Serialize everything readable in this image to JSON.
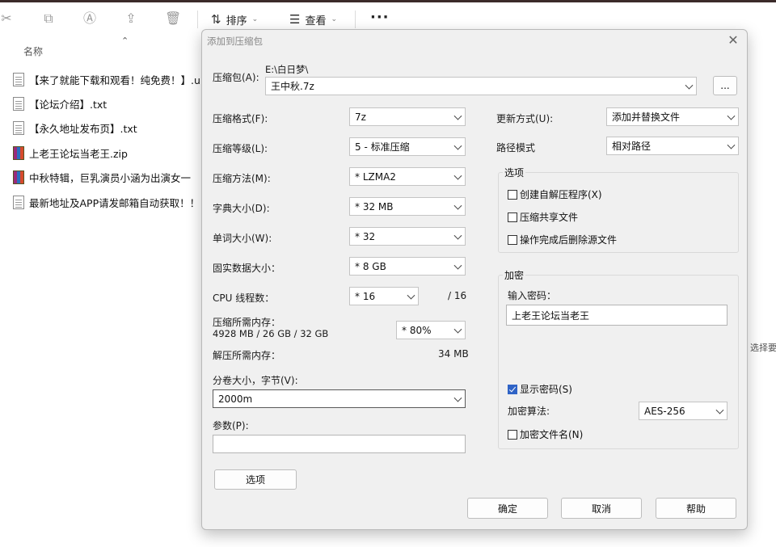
{
  "toolbar": {
    "sort_label": "排序",
    "view_label": "查看",
    "more_glyph": "···"
  },
  "explorer": {
    "column_name": "名称",
    "files": [
      {
        "name": "【来了就能下载和观看！纯免费！】.url",
        "type": "txt"
      },
      {
        "name": "【论坛介绍】.txt",
        "type": "txt"
      },
      {
        "name": "【永久地址发布页】.txt",
        "type": "txt"
      },
      {
        "name": "上老王论坛当老王.zip",
        "type": "zip"
      },
      {
        "name": "中秋特辑，巨乳演员小涵为出演女一",
        "type": "zip"
      },
      {
        "name": "最新地址及APP请发邮箱自动获取！！",
        "type": "txt"
      }
    ],
    "right_snippet": "选择要"
  },
  "dialog": {
    "title": "添加到压缩包",
    "archive_label": "压缩包(A):",
    "archive_dir": "E:\\白日梦\\",
    "archive_name": "王中秋.7z",
    "browse_label": "...",
    "format_label": "压缩格式(F):",
    "format_value": "7z",
    "level_label": "压缩等级(L):",
    "level_value": "5 - 标准压缩",
    "method_label": "压缩方法(M):",
    "method_value": "* LZMA2",
    "dict_label": "字典大小(D):",
    "dict_value": "* 32 MB",
    "word_label": "单词大小(W):",
    "word_value": "* 32",
    "solid_label": "固实数据大小：",
    "solid_value": "* 8 GB",
    "threads_label": "CPU 线程数：",
    "threads_value": "* 16",
    "threads_max": "/ 16",
    "mem_comp_label": "压缩所需内存：",
    "mem_comp_detail": "4928 MB / 26 GB / 32 GB",
    "mem_comp_value": "* 80%",
    "mem_decomp_label": "解压所需内存：",
    "mem_decomp_value": "34 MB",
    "split_label": "分卷大小，字节(V):",
    "split_value": "2000m",
    "params_label": "参数(P):",
    "params_value": "",
    "options_button": "选项",
    "update_label": "更新方式(U):",
    "update_value": "添加并替换文件",
    "path_label": "路径模式",
    "path_value": "相对路径",
    "options_group": "选项",
    "opt_sfx": "创建自解压程序(X)",
    "opt_shared": "压缩共享文件",
    "opt_delete": "操作完成后删除源文件",
    "encrypt_group": "加密",
    "password_label": "输入密码：",
    "password_value": "上老王论坛当老王",
    "show_password": "显示密码(S)",
    "method_enc_label": "加密算法:",
    "method_enc_value": "AES-256",
    "encrypt_names": "加密文件名(N)",
    "ok": "确定",
    "cancel": "取消",
    "help": "帮助"
  },
  "state": {
    "opt_sfx_checked": false,
    "opt_shared_checked": false,
    "opt_delete_checked": false,
    "show_password_checked": true,
    "encrypt_names_checked": false
  }
}
